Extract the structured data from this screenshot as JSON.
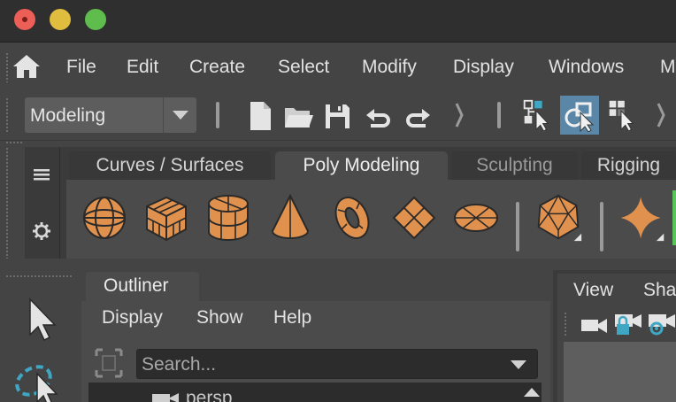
{
  "menubar": {
    "items": [
      "File",
      "Edit",
      "Create",
      "Select",
      "Modify",
      "Display",
      "Windows",
      "M"
    ]
  },
  "statusline": {
    "mode_value": "Modeling"
  },
  "shelf": {
    "tabs": [
      "Curves / Surfaces",
      "Poly Modeling",
      "Sculpting",
      "Rigging"
    ],
    "active_tab": "Poly Modeling",
    "icon_color": "#e0914d"
  },
  "outliner": {
    "tab_label": "Outliner",
    "menu": [
      "Display",
      "Show",
      "Help"
    ],
    "search_placeholder": "Search...",
    "first_item": "persp"
  },
  "viewport": {
    "menu": [
      "View",
      "Sha"
    ]
  },
  "colors": {
    "titlebar": "#2f2f2f",
    "panel": "#444444",
    "accent_teal": "#3fa6c4",
    "selected_tool_bg": "#5a87a8"
  }
}
